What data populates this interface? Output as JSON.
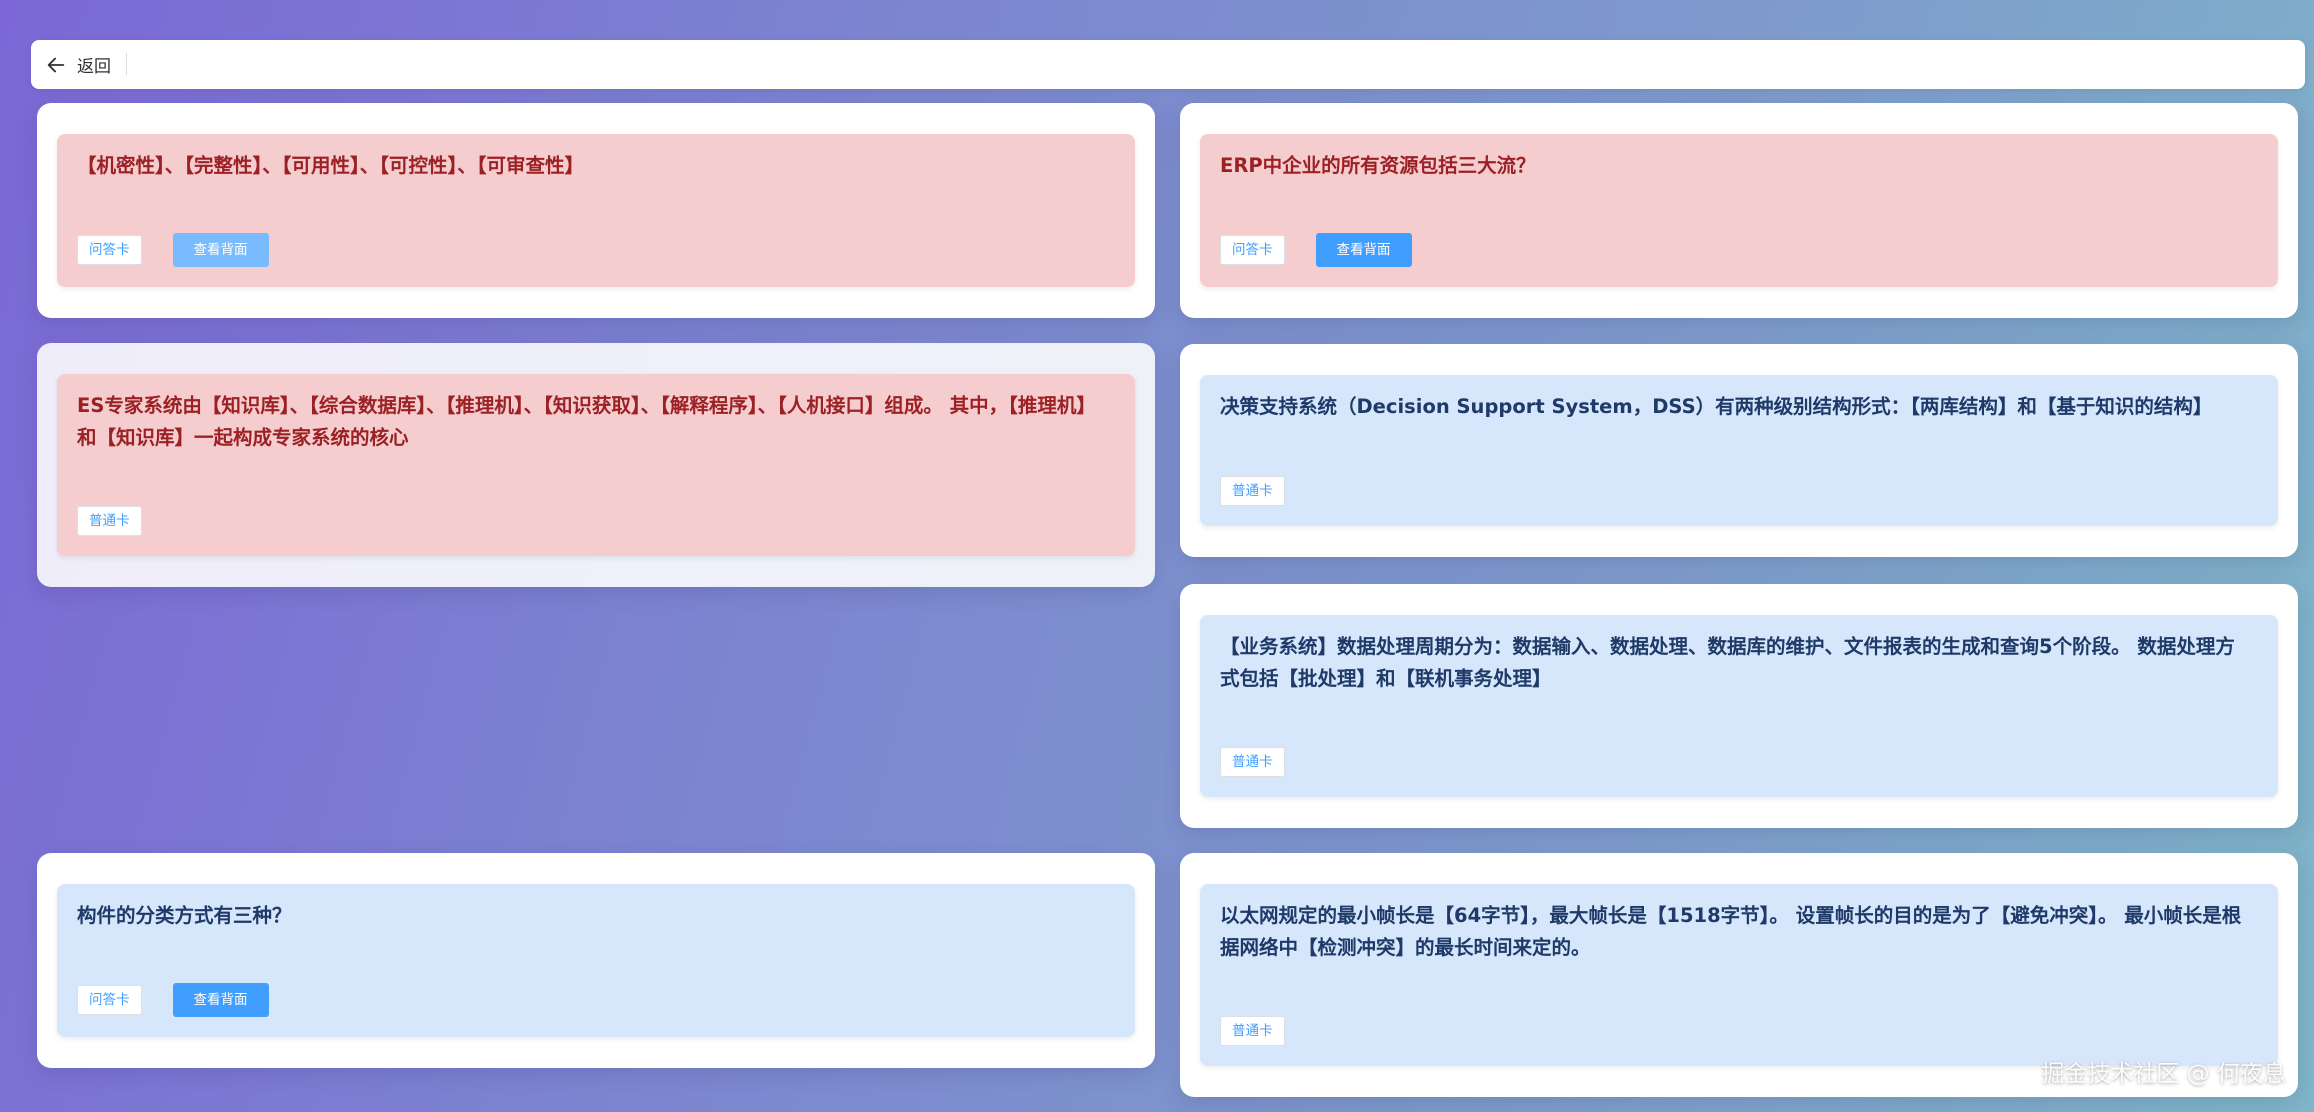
{
  "header": {
    "back_label": "返回"
  },
  "cards": [
    {
      "text": "【机密性】、【完整性】、【可用性】、【可控性】、【可审查性】",
      "tag": "问答卡",
      "button": "查看背面",
      "theme": "red"
    },
    {
      "text": "ERP中企业的所有资源包括三大流？",
      "tag": "问答卡",
      "button": "查看背面",
      "theme": "red"
    },
    {
      "text": "ES专家系统由【知识库】、【综合数据库】、【推理机】、【知识获取】、【解释程序】、【人机接口】组成。 其中，【推理机】和【知识库】一起构成专家系统的核心",
      "tag": "普通卡",
      "theme": "red"
    },
    {
      "text": "决策支持系统（Decision Support System，DSS）有两种级别结构形式：【两库结构】和【基于知识的结构】",
      "tag": "普通卡",
      "theme": "blue"
    },
    {
      "text": "【业务系统】数据处理周期分为：数据输入、数据处理、数据库的维护、文件报表的生成和查询5个阶段。 数据处理方式包括【批处理】和【联机事务处理】",
      "tag": "普通卡",
      "theme": "blue"
    },
    {
      "text": "构件的分类方式有三种？",
      "tag": "问答卡",
      "button": "查看背面",
      "theme": "blue"
    },
    {
      "text": "以太网规定的最小帧长是【64字节】，最大帧长是【1518字节】。 设置帧长的目的是为了【避免冲突】。 最小帧长是根据网络中【检测冲突】的最长时间来定的。",
      "tag": "普通卡",
      "theme": "blue"
    }
  ],
  "watermark": "掘金技术社区 @ 何夜息",
  "colors": {
    "red_card": "#f6cdce",
    "blue_card": "#d6e6fb",
    "primary_button": "#409eff",
    "light_button": "#79bbff",
    "tag_text": "#409eff"
  }
}
